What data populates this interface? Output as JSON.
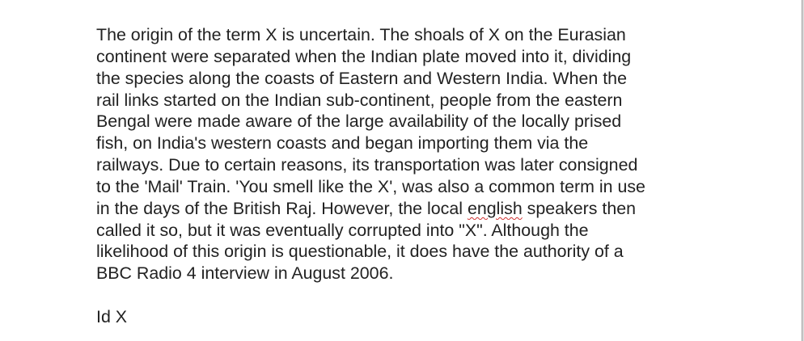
{
  "document": {
    "lines": [
      "The origin of the term X is uncertain. The shoals of X on the Eurasian",
      "continent were separated when the Indian plate moved into it, dividing",
      "the species along the coasts of Eastern and Western India. When the",
      "rail links started on the Indian sub-continent, people from the eastern",
      "Bengal were made aware of the large availability of the locally prised",
      "fish, on India's western coasts and began importing them via the",
      "railways. Due to certain reasons, its transportation was later consigned",
      "to the 'Mail' Train. 'You smell like the X', was also a common term in use",
      "in the days of the British Raj. However, the local english speakers then",
      "called it so, but it was eventually corrupted into \"X\". Although the",
      "likelihood of this origin is questionable, it does have the authority of a",
      "BBC Radio 4 interview in August 2006."
    ],
    "line9_parts": {
      "before": "in the days of the British Raj. However, the local ",
      "flagged": "english",
      "after": " speakers then"
    },
    "footer": "Id X"
  }
}
